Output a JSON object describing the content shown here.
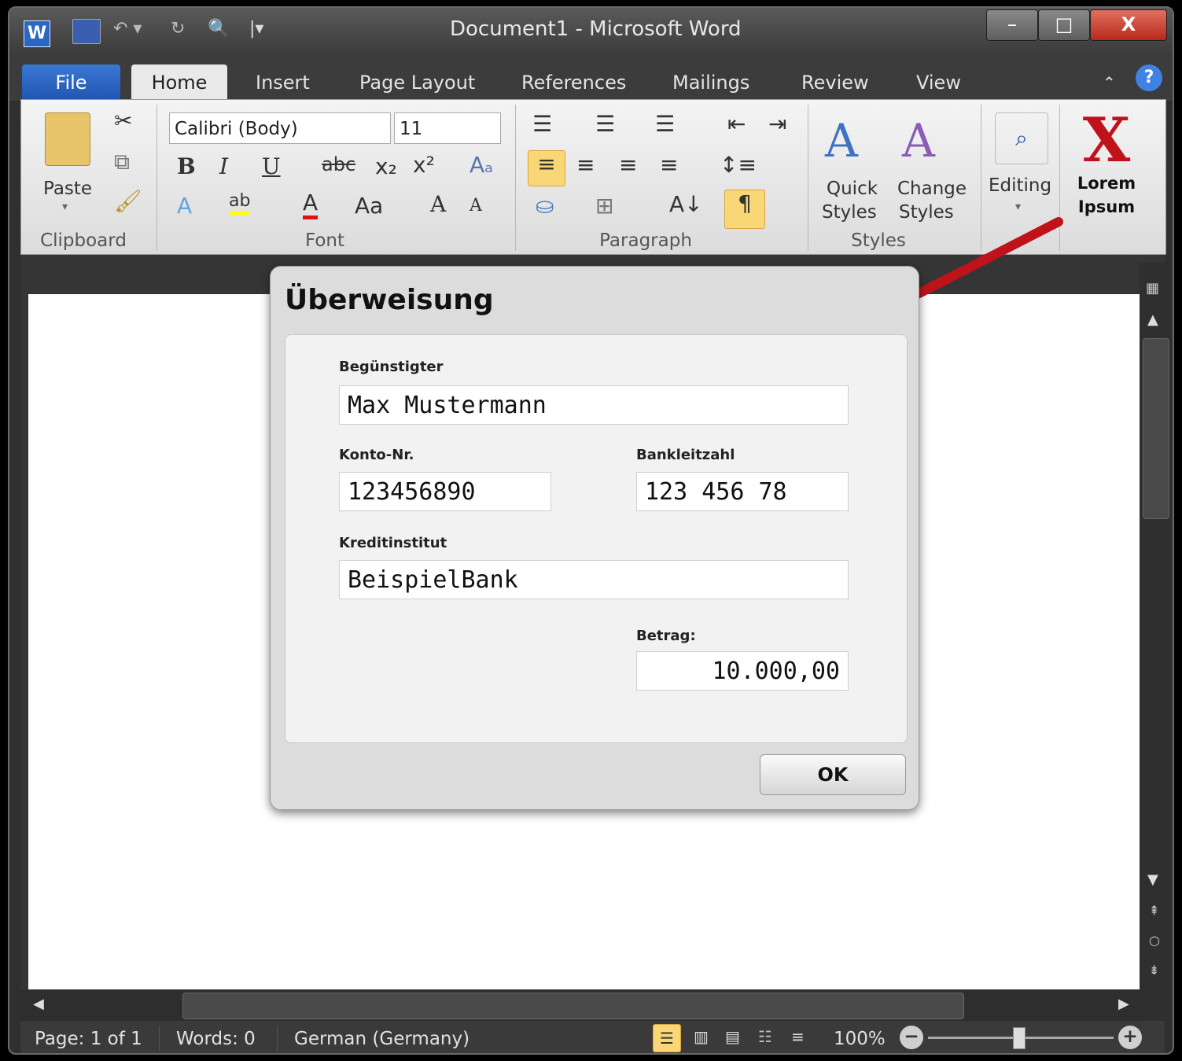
{
  "window": {
    "title": "Document1  -  Microsoft Word",
    "quick_access_icons": [
      "word-icon",
      "save-icon",
      "undo-icon",
      "redo-icon",
      "print-preview-icon",
      "customize-icon"
    ],
    "controls": {
      "minimize": "–",
      "maximize": "□",
      "close": "X"
    }
  },
  "tabs": [
    {
      "label": "File"
    },
    {
      "label": "Home"
    },
    {
      "label": "Insert"
    },
    {
      "label": "Page Layout"
    },
    {
      "label": "References"
    },
    {
      "label": "Mailings"
    },
    {
      "label": "Review"
    },
    {
      "label": "View"
    }
  ],
  "ribbon": {
    "clipboard": {
      "paste": "Paste",
      "group": "Clipboard"
    },
    "font": {
      "name": "Calibri (Body)",
      "size": "11",
      "group": "Font"
    },
    "paragraph": {
      "group": "Paragraph"
    },
    "styles": {
      "quick": "Quick",
      "quick2": "Styles",
      "change": "Change",
      "change2": "Styles",
      "group": "Styles"
    },
    "editing": {
      "label": "Editing"
    },
    "custom": {
      "label_line1": "Lorem",
      "label_line2": "Ipsum",
      "icon_glyph": "X"
    }
  },
  "dialog": {
    "title": "Überweisung",
    "fields": {
      "beneficiary_label": "Begünstigter",
      "beneficiary_value": "Max Mustermann",
      "account_label": "Konto-Nr.",
      "account_value": "123456890",
      "bank_code_label": "Bankleitzahl",
      "bank_code_value": "123 456 78",
      "institute_label": "Kreditinstitut",
      "institute_value": "BeispielBank",
      "amount_label": "Betrag:",
      "amount_value": "10.000,00"
    },
    "ok": "OK"
  },
  "status": {
    "page": "Page: 1 of 1",
    "words": "Words: 0",
    "language": "German (Germany)",
    "zoom": "100%"
  },
  "colors": {
    "file_tab": "#2a66c4",
    "arrow": "#c0121b",
    "lorem_x": "#c0121b",
    "highlight": "#f9d776"
  }
}
